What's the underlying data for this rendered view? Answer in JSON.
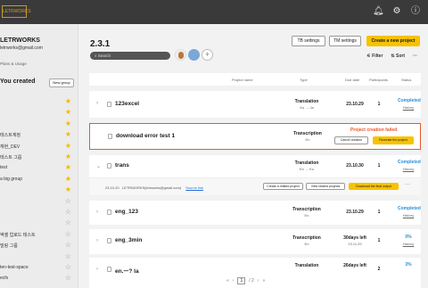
{
  "app": {
    "logo_text": "LETRWORKS"
  },
  "topbar": {
    "icons": [
      "bell-icon",
      "settings-icon",
      "info-icon"
    ]
  },
  "sidebar": {
    "workspace_name": "LETRWORKS",
    "workspace_email": "letrworks@gmail.com",
    "plans_label": "Plans & Usage",
    "groups_title": "You created",
    "new_group_label": "New group",
    "items": [
      {
        "label": "",
        "starred": true
      },
      {
        "label": "",
        "starred": true
      },
      {
        "label": "",
        "starred": true
      },
      {
        "label": "테스트계정",
        "starred": true
      },
      {
        "label": "재현_DEV",
        "starred": true
      },
      {
        "label": "테스트 그룹",
        "starred": true
      },
      {
        "label": "test",
        "starred": true
      },
      {
        "label": "a big group",
        "starred": true
      },
      {
        "label": "",
        "starred": true
      },
      {
        "label": "",
        "starred": false
      },
      {
        "label": "",
        "starred": false
      },
      {
        "label": "",
        "starred": false
      },
      {
        "label": "엑셀 업로드 테스트",
        "starred": false
      },
      {
        "label": "빌링 그룹",
        "starred": false
      },
      {
        "label": "",
        "starred": false
      },
      {
        "label": "ten-test-space",
        "starred": false
      },
      {
        "label": "ecfs",
        "starred": false
      }
    ]
  },
  "header": {
    "title": "2.3.1",
    "search_placeholder": "Search",
    "tb_settings": "TB settings",
    "tm_settings": "TM settings",
    "create_project": "Create a new project",
    "filter_label": "Filter",
    "sort_label": "Sort",
    "more_label": "···"
  },
  "table": {
    "columns": [
      "Project name",
      "Type",
      "Due date",
      "Participants",
      "Status"
    ],
    "rows": [
      {
        "name": "123excel",
        "type": "Translation",
        "lang": "Ko → Ja",
        "due": "23.10.29",
        "due2": "",
        "participants": "1",
        "status": "Completed",
        "history": "History"
      },
      {
        "name": "download error test 1",
        "type": "Transcription",
        "lang": "En",
        "failed_title": "Project creation failed",
        "cancel_label": "Cancel creation",
        "recreate_label": "Recreate the project"
      },
      {
        "name": "trans",
        "type": "Translation",
        "lang": "En → Ko",
        "due": "23.10.30",
        "due2": "",
        "participants": "1",
        "status": "Completed",
        "history": "History"
      },
      {
        "name": "eng_123",
        "type": "Transcription",
        "lang": "En",
        "due": "23.10.29",
        "due2": "",
        "participants": "1",
        "status": "Completed",
        "history": "History"
      },
      {
        "name": "eng_3min",
        "type": "Transcription",
        "lang": "En",
        "due": "30days left",
        "due2": "23.11.29",
        "participants": "1",
        "status": "0%",
        "history": "History"
      },
      {
        "name": "en.ㅡ? la",
        "type": "Translation",
        "lang": "",
        "due": "26days left",
        "due2": "",
        "participants": "2",
        "status": "3%",
        "history": ""
      }
    ],
    "expanded": {
      "date": "23.10.20",
      "owner": "LETRWORKS(letrworks@gmail.com)",
      "source_link": "Source link",
      "create_related": "Create a related project",
      "view_related": "View related projects",
      "download_final": "Download the final output",
      "more": "···"
    }
  },
  "pager": {
    "first": "«",
    "prev": "‹",
    "current": "1",
    "total": "/ 2",
    "next": "›",
    "last": "»"
  },
  "colors": {
    "accent": "#f7c200",
    "error": "#e8572e",
    "status_blue": "#2a8fd8",
    "topbar": "#3a3a3a"
  }
}
